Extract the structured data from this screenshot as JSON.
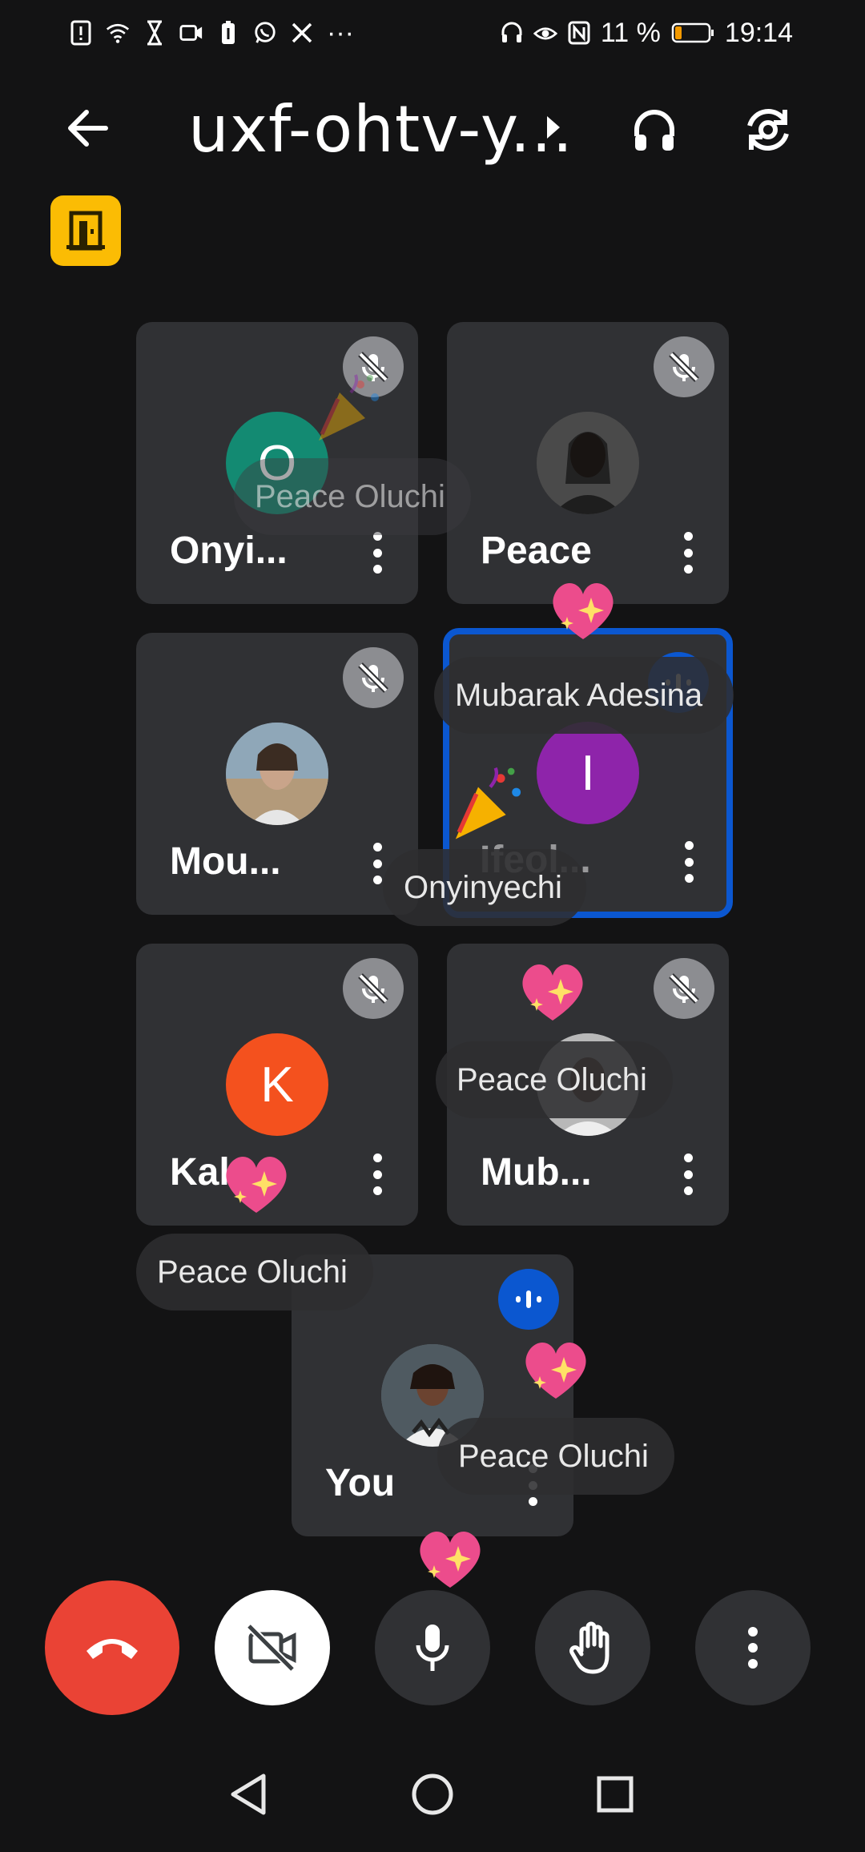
{
  "status_bar": {
    "battery": "11 %",
    "time": "19:14",
    "overflow": "···",
    "left_icons": [
      "alert-icon",
      "wifi-icon",
      "hourglass-icon",
      "video-icon",
      "battery-saver-icon",
      "whatsapp-icon",
      "x-icon"
    ],
    "right_icons": [
      "headset-icon",
      "eye-icon",
      "nfc-icon",
      "battery-icon"
    ]
  },
  "header": {
    "title": "uxf-ohtv-y...",
    "door_badge_icon": "door-icon"
  },
  "tiles": [
    {
      "short": "Onyi...",
      "initial": "O",
      "color": "#138a72",
      "mic": "muted"
    },
    {
      "short": "Peace",
      "initial": "",
      "color": "#3a3a3a",
      "mic": "muted"
    },
    {
      "short": "Mou...",
      "initial": "",
      "color": "#7a8a96",
      "mic": "muted"
    },
    {
      "short": "Ifeol...",
      "initial": "I",
      "color": "#8e24aa",
      "mic": "speaking"
    },
    {
      "short": "Kalo",
      "initial": "K",
      "color": "#f4511e",
      "mic": "muted"
    },
    {
      "short": "Mub...",
      "initial": "",
      "color": "#9aa0a6",
      "mic": "muted"
    },
    {
      "short": "You",
      "initial": "",
      "color": "#5f6b73",
      "mic": "speaking"
    }
  ],
  "name_chips": [
    {
      "text": "Peace Oluchi",
      "faded": true
    },
    {
      "text": "Mubarak Adesina",
      "faded": false
    },
    {
      "text": "Onyinyechi",
      "faded": false
    },
    {
      "text": "Peace Oluchi",
      "faded": false
    },
    {
      "text": "Peace Oluchi",
      "faded": false
    },
    {
      "text": "Peace Oluchi",
      "faded": false
    }
  ],
  "controls": [
    "end-call",
    "camera-off",
    "microphone",
    "raise-hand",
    "more-options"
  ],
  "colors": {
    "background": "#131314",
    "tile": "#303134",
    "end_call": "#ea4335",
    "active_border": "#0b57d0",
    "badge": "#fbbc04"
  }
}
